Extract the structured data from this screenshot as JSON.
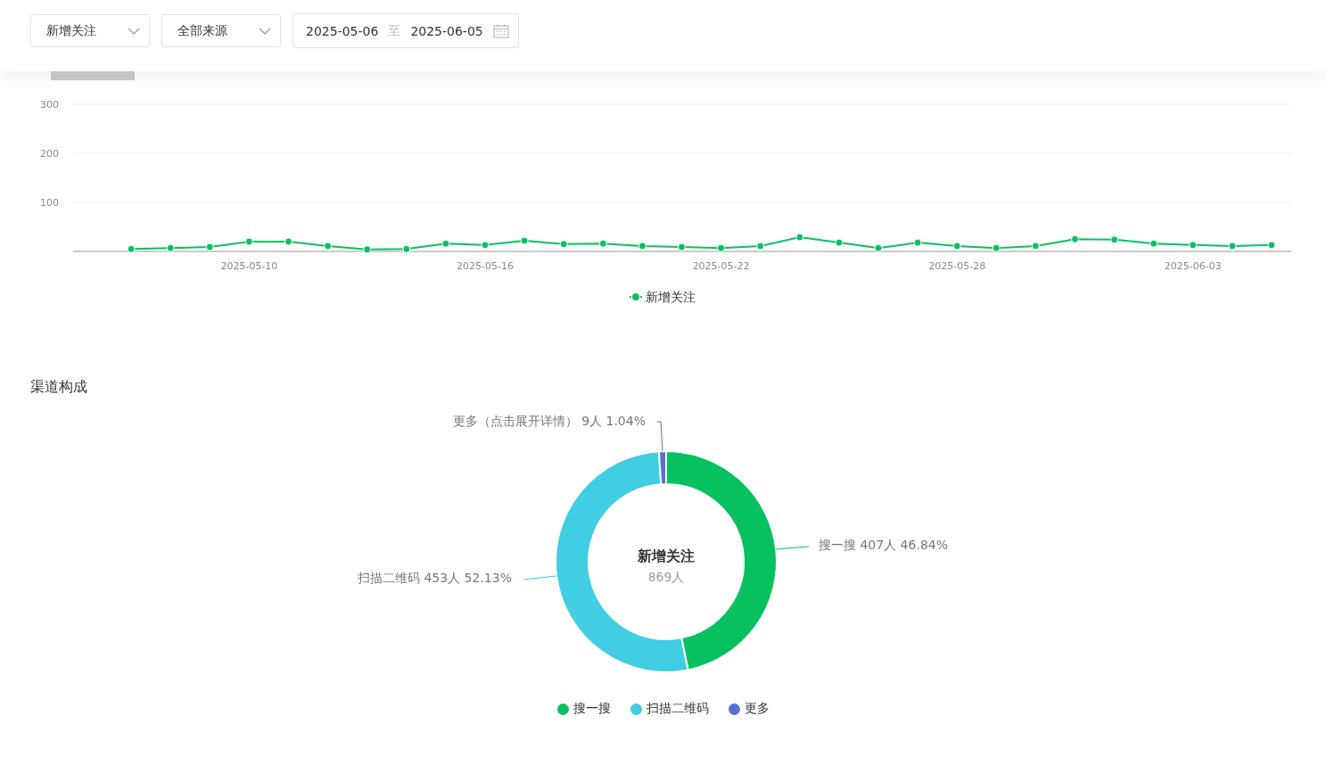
{
  "filters": [
    {
      "kind": "select",
      "value": "新增关注"
    },
    {
      "kind": "select",
      "value": "全部来源"
    }
  ],
  "date_range": {
    "start": "2025-05-06",
    "separator": "至",
    "end": "2025-06-05"
  },
  "trend_chart": {
    "chart_data": {
      "type": "line",
      "categories": [
        null,
        null,
        null,
        null,
        "2025-05-10",
        null,
        null,
        null,
        null,
        null,
        "2025-05-16",
        null,
        null,
        null,
        null,
        null,
        "2025-05-22",
        null,
        null,
        null,
        null,
        null,
        "2025-05-28",
        null,
        null,
        null,
        null,
        null,
        "2025-06-03",
        null,
        null
      ],
      "ylim": [
        0,
        300
      ],
      "yticks": [
        100,
        200,
        300
      ],
      "grid": true,
      "series": [
        {
          "name": "新增关注",
          "color": "#07c160",
          "marker": true,
          "values": [
            null,
            5,
            7,
            9,
            20,
            20,
            11,
            4,
            5,
            16,
            13,
            22,
            15,
            16,
            11,
            9,
            7,
            11,
            29,
            18,
            7,
            18,
            11,
            7,
            11,
            25,
            24,
            16,
            13,
            11,
            13
          ]
        }
      ]
    }
  },
  "composition": {
    "title": "渠道构成",
    "chart_data": {
      "type": "donut",
      "categories": [
        "搜一搜",
        "扫描二维码",
        "更多"
      ],
      "series": [
        {
          "name": "新增关注",
          "values": [
            46.84,
            52.13,
            1.04
          ]
        }
      ]
    },
    "center_value": "869人",
    "slice_labels": [
      {
        "text": "搜一搜 407人 46.84%"
      },
      {
        "text": "扫描二维码 453人 52.13%"
      },
      {
        "text": "更多（点击展开详情） 9人 1.04%"
      }
    ],
    "slice_colors": [
      {
        "color": "#07c160"
      },
      {
        "color": "#41cde2"
      },
      {
        "color": "#5b6fd1"
      }
    ]
  }
}
